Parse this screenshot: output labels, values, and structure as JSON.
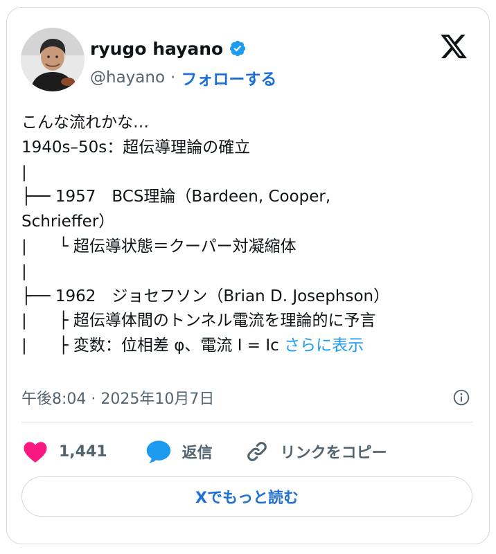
{
  "author": {
    "display_name": "ryugo hayano",
    "handle": "@hayano",
    "separator": "·",
    "follow_label": "フォローする"
  },
  "icons": {
    "avatar": "profile-photo",
    "verified": "verified-badge-icon",
    "logo": "x-logo-icon",
    "info": "info-icon",
    "like": "heart-icon",
    "reply": "speech-bubble-icon",
    "copy": "link-icon"
  },
  "colors": {
    "accent": "#1d9bf0",
    "like": "#f91880",
    "muted": "#536471",
    "text": "#0f1419"
  },
  "post": {
    "lines": [
      "こんな流れかな…",
      "1940s–50s：超伝導理論の確立",
      "|",
      "├── 1957　BCS理論（Bardeen, Cooper,",
      "Schrieffer）",
      "|　　└ 超伝導状態＝クーパー対凝縮体",
      "|",
      "├── 1962　ジョセフソン（Brian D. Josephson）",
      "|　　├ 超伝導体間のトンネル電流を理論的に予言",
      "|　　├ 変数：位相差 φ、電流 I = Ic"
    ],
    "show_more": "さらに表示",
    "timestamp": "午後8:04 · 2025年10月7日"
  },
  "actions": {
    "like_count": "1,441",
    "reply_label": "返信",
    "copy_label": "リンクをコピー"
  },
  "read_more_label": "Xでもっと読む"
}
